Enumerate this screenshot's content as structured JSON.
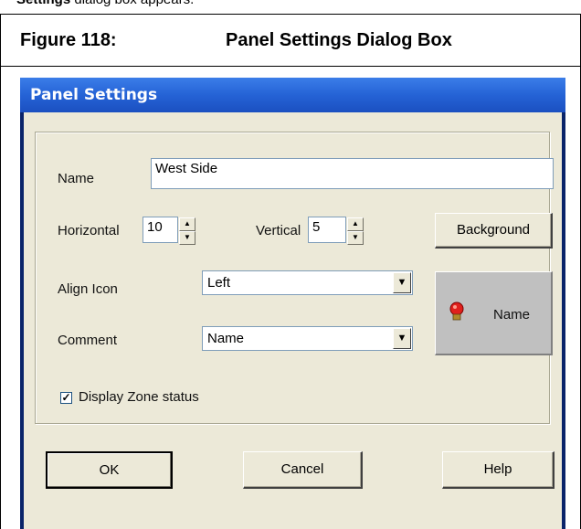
{
  "cropped_caption": {
    "bold": "Settings",
    "rest": " dialog box appears."
  },
  "figure": {
    "number": "Figure 118:",
    "title": "Panel Settings Dialog Box"
  },
  "dialog": {
    "title": "Panel Settings",
    "name_label": "Name",
    "name_value": "West Side",
    "horizontal_label": "Horizontal",
    "horizontal_value": "10",
    "vertical_label": "Vertical",
    "vertical_value": "5",
    "background_button": "Background",
    "align_icon_label": "Align Icon",
    "align_icon_value": "Left",
    "comment_label": "Comment",
    "comment_value": "Name",
    "preview_text": "Name",
    "display_zone_label": "Display Zone status",
    "display_zone_checked": true,
    "ok_button": "OK",
    "cancel_button": "Cancel",
    "help_button": "Help"
  },
  "colors": {
    "titlebar": "#2563d6",
    "dialog_face": "#ece9d8",
    "preview_bg": "#c0c0c0",
    "bulb": "#e0201c"
  },
  "icons": {
    "bulb": "red-bulb-icon",
    "spin_up": "spin-up-icon",
    "spin_down": "spin-down-icon",
    "dropdown": "dropdown-arrow-icon",
    "check": "checkmark-icon"
  }
}
